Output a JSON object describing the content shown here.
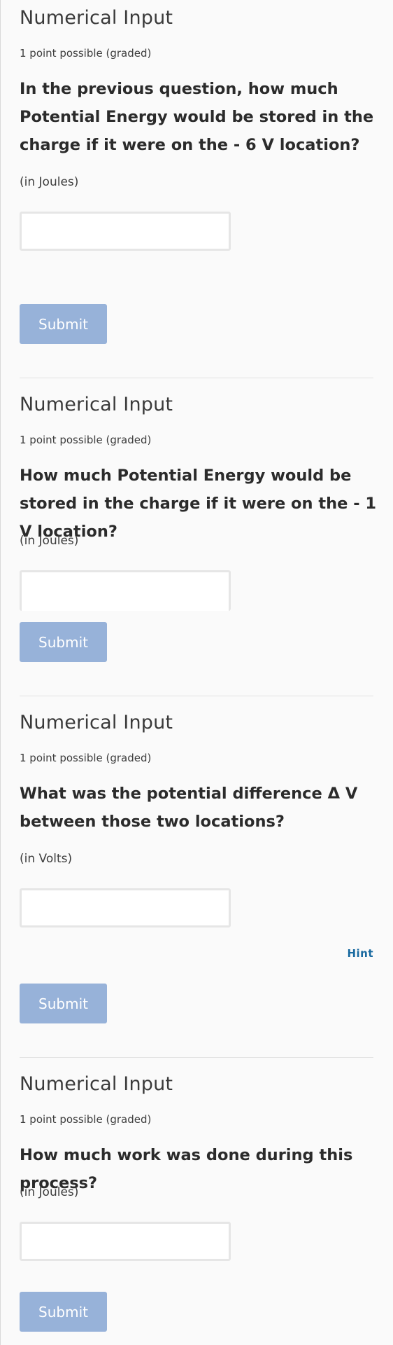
{
  "problems": [
    {
      "title": "Numerical Input",
      "points": "1 point possible (graded)",
      "question": "In the previous question, how much Potential Energy would be stored in the charge if it were on the - 6 V location?",
      "unit": "(in Joules)",
      "answer": "",
      "submit_label": "Submit"
    },
    {
      "title": "Numerical Input",
      "points": "1 point possible (graded)",
      "question": "How much Potential Energy would be stored in the charge if it were on the - 1 V location?",
      "unit": "(in Joules)",
      "answer": "",
      "submit_label": "Submit"
    },
    {
      "title": "Numerical Input",
      "points": "1 point possible (graded)",
      "question": "What was the potential difference Δ V between those two locations?",
      "unit": "(in Volts)",
      "answer": "",
      "hint_label": "Hint",
      "submit_label": "Submit"
    },
    {
      "title": "Numerical Input",
      "points": "1 point possible (graded)",
      "question": "How much work was done during this process?",
      "unit": "(in Joules)",
      "answer": "",
      "submit_label": "Submit"
    }
  ],
  "colors": {
    "submit_bg": "#97b2d9",
    "submit_text": "#ffffff",
    "hint": "#1a6aa0",
    "page_bg": "#fafafa"
  }
}
